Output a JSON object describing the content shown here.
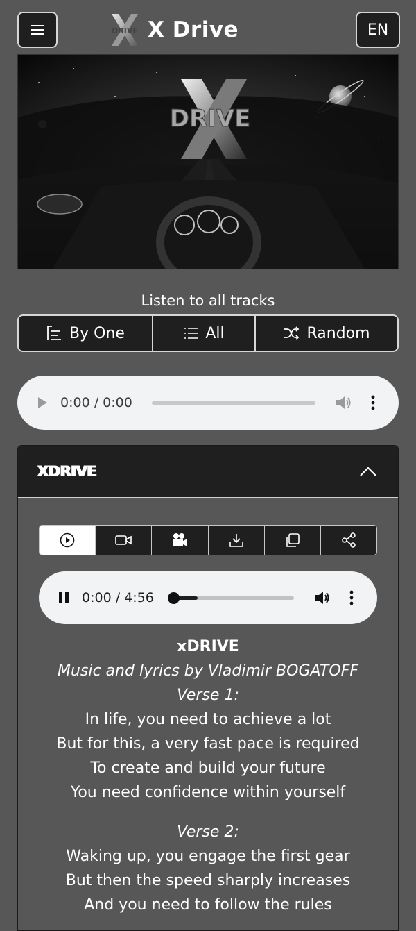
{
  "header": {
    "menu_icon": "hamburger-icon",
    "brand_title": "X Drive",
    "logo_text": "DRIVE",
    "language": "EN"
  },
  "hero": {
    "logo_text": "DRIVE"
  },
  "listen": {
    "title": "Listen to all tracks",
    "buttons": [
      {
        "label": "By One",
        "icon": "sort-list-icon"
      },
      {
        "label": "All",
        "icon": "numbered-list-icon"
      },
      {
        "label": "Random",
        "icon": "shuffle-icon"
      }
    ]
  },
  "player_main": {
    "time": "0:00 / 0:00"
  },
  "track": {
    "header_title": "XDRIVE",
    "tools": [
      "play-circle-icon",
      "video-icon",
      "camera-icon",
      "download-icon",
      "copy-icon",
      "share-icon"
    ],
    "player": {
      "time": "0:00 / 4:56",
      "progress": 0.2
    },
    "song_title": "xDRIVE",
    "credit": "Music and lyrics by Vladimir BOGATOFF",
    "verse1_label": "Verse 1:",
    "verse1": [
      "In life, you need to achieve a lot",
      "But for this, a very fast pace is required",
      "To create and build your future",
      "You need confidence within yourself"
    ],
    "verse2_label": "Verse 2:",
    "verse2": [
      "Waking up, you engage the first gear",
      "But then the speed sharply increases",
      "And you need to follow the rules"
    ]
  },
  "colors": {
    "background": "#575757",
    "panel": "#1f1f1f",
    "border": "#d7d7d7",
    "player": "#f1f3f4"
  }
}
